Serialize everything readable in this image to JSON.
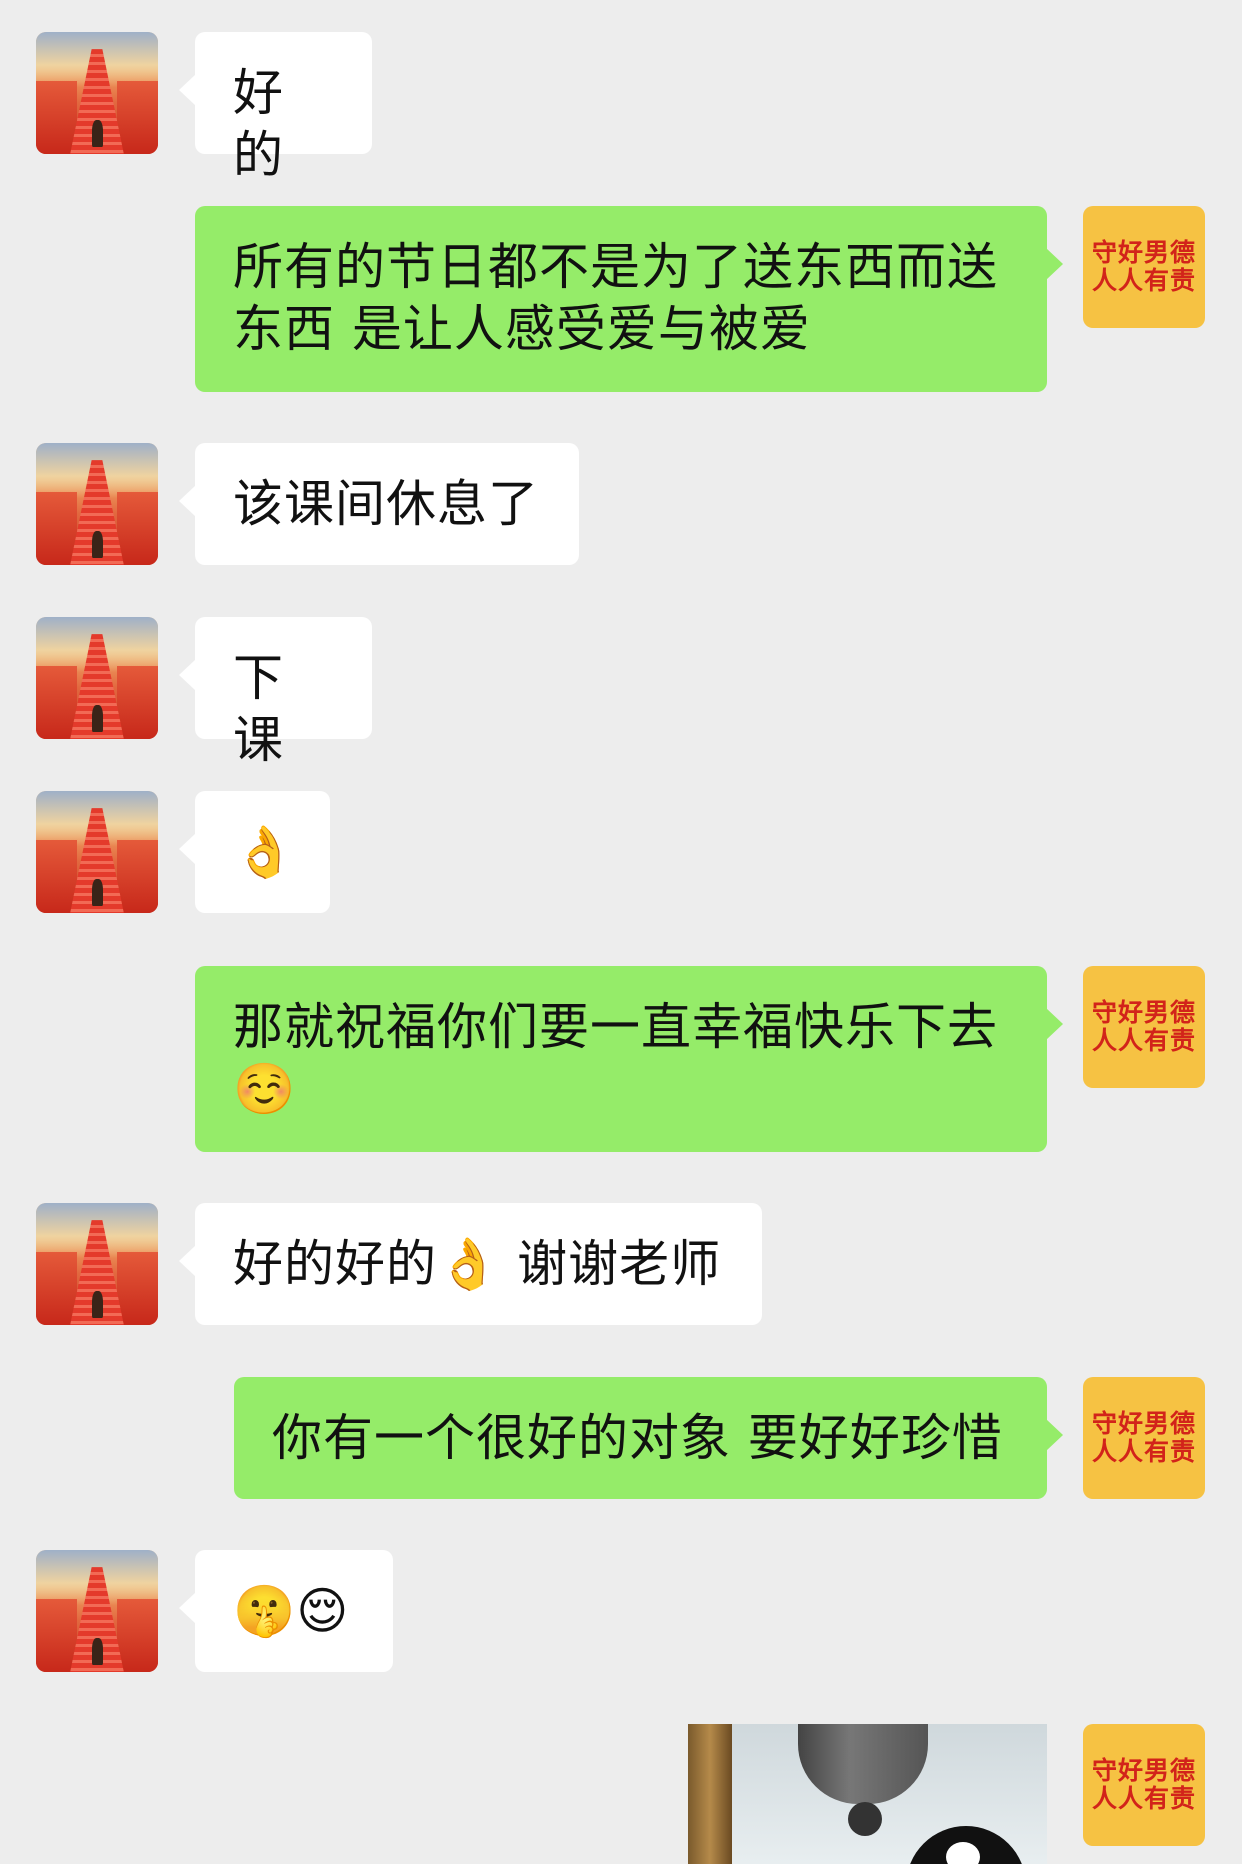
{
  "colors": {
    "background": "#ededed",
    "incoming_bubble": "#ffffff",
    "outgoing_bubble": "#95ec69",
    "badge_yellow": "#f6c243",
    "badge_red": "#d2231a"
  },
  "right_avatar": {
    "line1": "守好男德",
    "line2": "人人有责"
  },
  "messages": [
    {
      "side": "in",
      "text": "好的"
    },
    {
      "side": "out",
      "line1": "所有的节日都不是为了送东西而送",
      "line2": "东西 是让人感受爱与被爱"
    },
    {
      "side": "in",
      "text": "该课间休息了"
    },
    {
      "side": "in",
      "text": "下课"
    },
    {
      "side": "in",
      "emoji": "👌",
      "emoji_name": "ok-hand-emoji"
    },
    {
      "side": "out",
      "line1": "那就祝福你们要一直幸福快乐下去",
      "emoji": "☺️",
      "emoji_name": "smiling-face-emoji"
    },
    {
      "side": "in",
      "text_a": "好的好的",
      "emoji": "👌",
      "text_b": " 谢谢老师"
    },
    {
      "side": "out",
      "text": "你有一个很好的对象 要好好珍惜"
    },
    {
      "side": "in",
      "emoji_a": "🤫",
      "emoji_b": "😌"
    },
    {
      "side": "out",
      "type": "image",
      "image_name": "bell-and-penguin-photo"
    }
  ]
}
